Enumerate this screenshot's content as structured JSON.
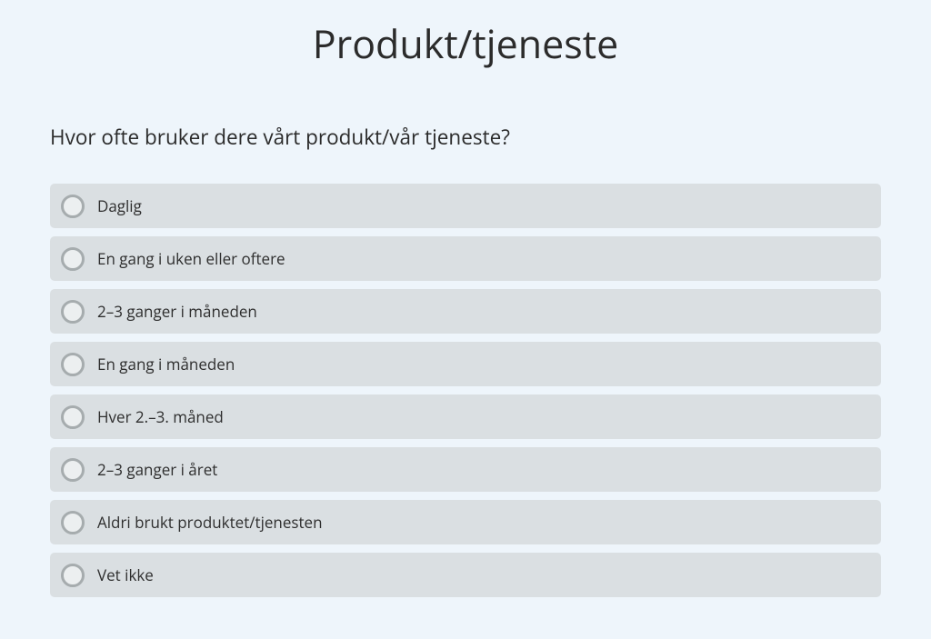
{
  "title": "Produkt/tjeneste",
  "question": "Hvor ofte bruker dere vårt produkt/vår tjeneste?",
  "options": [
    "Daglig",
    "En gang i uken eller oftere",
    "2–3 ganger i måneden",
    "En gang i måneden",
    "Hver 2.–3. måned",
    "2–3 ganger i året",
    "Aldri brukt produktet/tjenesten",
    "Vet ikke"
  ]
}
